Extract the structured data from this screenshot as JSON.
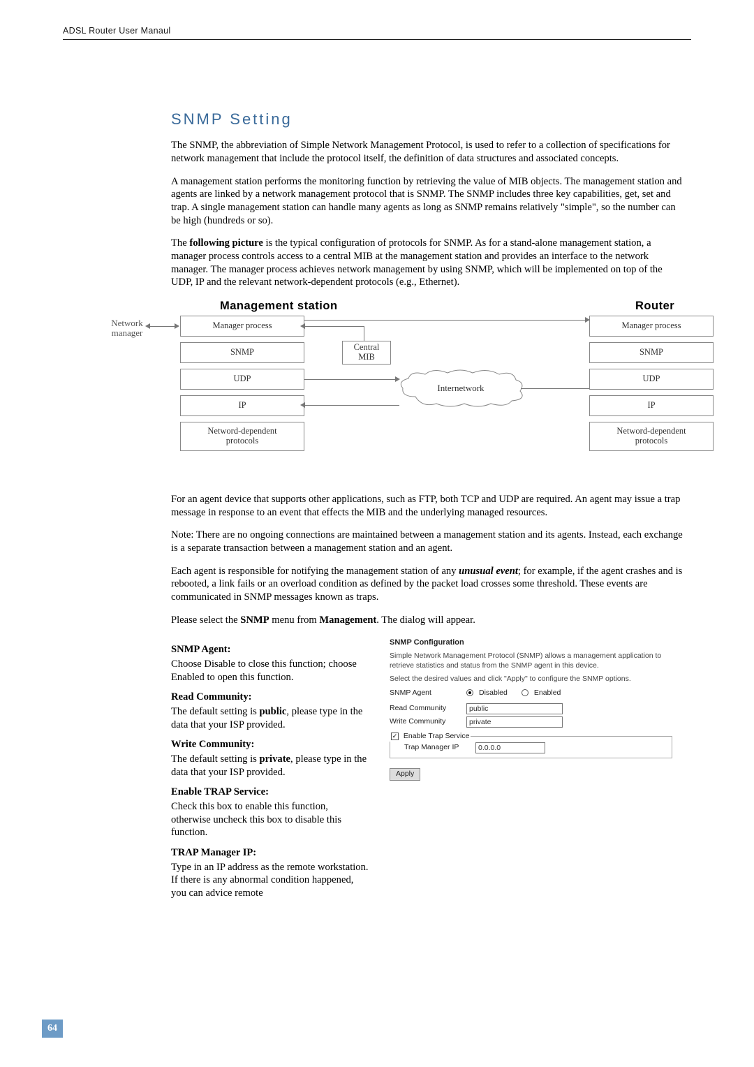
{
  "header": {
    "running": "ADSL Router User Manaul"
  },
  "section": {
    "title": "SNMP Setting"
  },
  "paras": {
    "p1": "The SNMP, the abbreviation of Simple Network Management Protocol, is used to refer to a collection of specifications for network management that include the protocol itself, the definition of data structures and associated concepts.",
    "p2": "A management station performs the monitoring function by retrieving the value of MIB objects. The management station and agents are linked by a network management protocol that is SNMP. The SNMP includes three key capabilities, get, set and trap. A single management station can handle many agents as long as SNMP remains relatively \"simple\", so the number can be high (hundreds or so).",
    "p3a": "The ",
    "p3b": "following picture",
    "p3c": " is the typical configuration of protocols for SNMP. As for a stand-alone management station, a manager process controls access to a central MIB at the management station and provides an interface to the network manager. The manager process achieves network management by using SNMP, which will be implemented on top of the UDP, IP and the relevant network-dependent protocols (e.g., Ethernet).",
    "p4": "For an agent device that supports other applications, such as FTP, both TCP and UDP are required. An agent may issue a trap message in response to an event that effects the MIB and the underlying managed resources.",
    "p5": "Note: There are no ongoing connections are maintained between a management station and its agents. Instead, each exchange is a separate transaction between a management station and an agent.",
    "p6a": "Each agent is responsible for notifying the management station of any ",
    "p6b": "unusual event",
    "p6c": "; for example, if the agent crashes and is rebooted, a link fails or an overload condition as defined by the packet load crosses some threshold. These events are communicated in SNMP messages known as traps.",
    "p7a": "Please select the ",
    "p7b": "SNMP",
    "p7c": " menu from ",
    "p7d": "Management",
    "p7e": ". The dialog will appear."
  },
  "diagram": {
    "title_left": "Management station",
    "title_right": "Router",
    "net_mgr_l1": "Network",
    "net_mgr_l2": "manager",
    "left_stack": [
      "Manager process",
      "SNMP",
      "UDP",
      "IP",
      "Netword-dependent\nprotocols"
    ],
    "right_stack": [
      "Manager process",
      "SNMP",
      "UDP",
      "IP",
      "Netword-dependent\nprotocols"
    ],
    "central_l1": "Central",
    "central_l2": "MIB",
    "cloud_label": "Internetwork"
  },
  "left_items": [
    {
      "head": "SNMP Agent:",
      "body": "Choose Disable to close this function; choose Enabled to open this function."
    },
    {
      "head": "Read Community:",
      "body_pre": "The default setting is ",
      "body_bold": "public",
      "body_post": ", please type in the data that your ISP provided."
    },
    {
      "head": "Write Community:",
      "body_pre": "The default setting is ",
      "body_bold": "private",
      "body_post": ", please type in the data that your ISP provided."
    },
    {
      "head": "Enable TRAP Service:",
      "body": "Check this box to enable this function, otherwise uncheck this box to disable this function."
    },
    {
      "head": "TRAP Manager IP:",
      "body": "Type in an IP address as the remote workstation. If there is any abnormal condition happened, you can advice remote"
    }
  ],
  "panel": {
    "title": "SNMP Configuration",
    "desc": "Simple Network Management Protocol (SNMP) allows a management application to retrieve statistics and status from the SNMP agent in this device.",
    "hint": "Select the desired values and click \"Apply\" to configure the SNMP options.",
    "agent_label": "SNMP Agent",
    "disabled_label": "Disabled",
    "enabled_label": "Enabled",
    "read_label": "Read Community",
    "read_value": "public",
    "write_label": "Write Community",
    "write_value": "private",
    "trap_cb_label": "Enable Trap Service",
    "trap_ip_label": "Trap Manager IP",
    "trap_ip_value": "0.0.0.0",
    "apply_label": "Apply"
  },
  "page_number": "64"
}
